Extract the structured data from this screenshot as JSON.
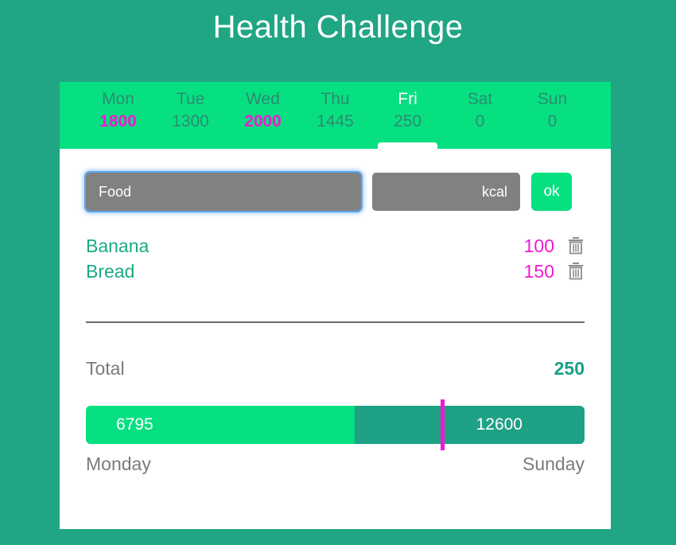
{
  "app": {
    "title": "Health Challenge",
    "background_color": "#20a684",
    "accent_green": "#06e081",
    "accent_magenta": "#f318d1",
    "accent_teal": "#16a085"
  },
  "tabs": [
    {
      "day": "Mon",
      "value": "1800",
      "active": false,
      "over_goal": true
    },
    {
      "day": "Tue",
      "value": "1300",
      "active": false,
      "over_goal": false
    },
    {
      "day": "Wed",
      "value": "2000",
      "active": false,
      "over_goal": true
    },
    {
      "day": "Thu",
      "value": "1445",
      "active": false,
      "over_goal": false
    },
    {
      "day": "Fri",
      "value": "250",
      "active": true,
      "over_goal": false
    },
    {
      "day": "Sat",
      "value": "0",
      "active": false,
      "over_goal": false
    },
    {
      "day": "Sun",
      "value": "0",
      "active": false,
      "over_goal": false
    }
  ],
  "entry": {
    "food_value": "Food",
    "food_placeholder": "Food",
    "kcal_value": "",
    "kcal_placeholder": "kcal",
    "ok_label": "ok"
  },
  "foods": [
    {
      "name": "Banana",
      "kcal": "100",
      "delete_icon": "trash-icon"
    },
    {
      "name": "Bread",
      "kcal": "150",
      "delete_icon": "trash-icon"
    }
  ],
  "total": {
    "label": "Total",
    "value": "250"
  },
  "week": {
    "current": "6795",
    "goal": "12600",
    "fill_percent": 53.9,
    "marker_percent": 71.1,
    "start_label": "Monday",
    "end_label": "Sunday"
  }
}
